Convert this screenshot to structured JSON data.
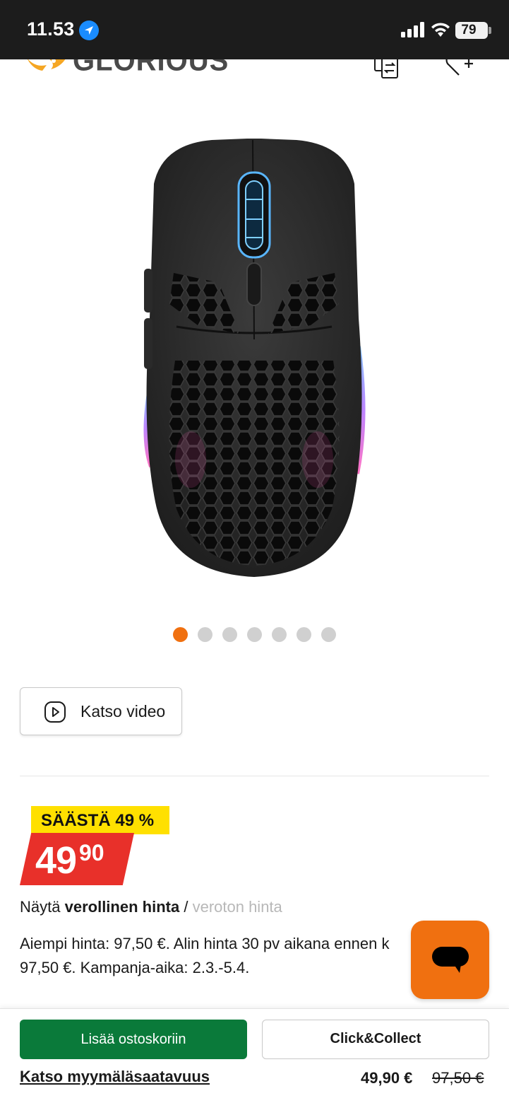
{
  "status_bar": {
    "time": "11.53",
    "battery": "79",
    "icons": [
      "location-arrow-icon",
      "cellular-signal-icon",
      "wifi-icon",
      "battery-icon"
    ]
  },
  "header": {
    "brand": "GLORIOUS",
    "icons": [
      "compare-icon",
      "wishlist-add-icon"
    ]
  },
  "product": {
    "image_alt": "mouse"
  },
  "carousel": {
    "total": 7,
    "active_index": 0,
    "active_color": "#f07010"
  },
  "video": {
    "label": "Katso video",
    "icon": "play-icon"
  },
  "price": {
    "save_label": "SÄÄSTÄ 49 %",
    "integer": "49",
    "decimals": "90",
    "badge_color": "#ffe000",
    "tag_color": "#e8302a"
  },
  "tax_toggle": {
    "prefix": "Näytä",
    "incl": "verollinen hinta",
    "separator": "/",
    "excl": "veroton hinta"
  },
  "price_history": {
    "line1": "Aiempi hinta: 97,50 €. Alin hinta 30 pv aikana ennen k",
    "line2": "97,50 €. Kampanja-aika: 2.3.-5.4."
  },
  "chat": {
    "icon": "chat-bubble-icon",
    "color": "#f07010"
  },
  "bottom_bar": {
    "add_to_cart": "Lisää ostoskoriin",
    "click_collect": "Click&Collect",
    "availability": "Katso myymäläsaatavuus",
    "current_price": "49,90 €",
    "old_price": "97,50 €",
    "cart_color": "#0a7a3a"
  }
}
